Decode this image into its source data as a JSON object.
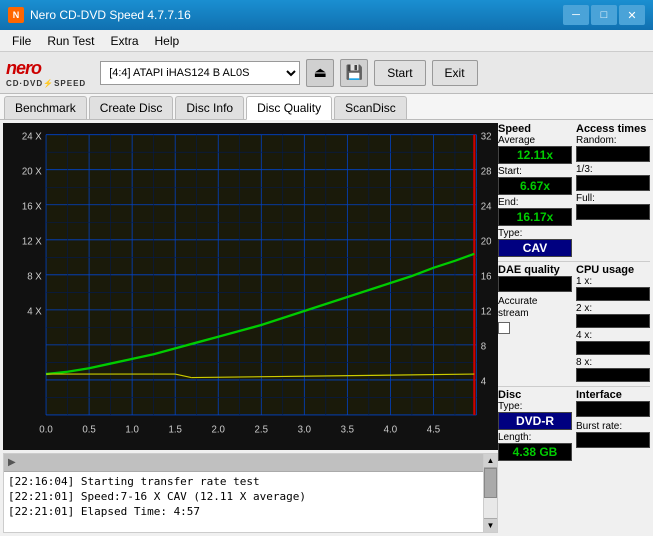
{
  "titleBar": {
    "title": "Nero CD-DVD Speed 4.7.7.16",
    "minBtn": "─",
    "maxBtn": "□",
    "closeBtn": "✕"
  },
  "menuBar": {
    "items": [
      "File",
      "Run Test",
      "Extra",
      "Help"
    ]
  },
  "toolbar": {
    "driveLabel": "[4:4]  ATAPI iHAS124  B AL0S",
    "startBtn": "Start",
    "exitBtn": "Exit"
  },
  "tabs": {
    "items": [
      "Benchmark",
      "Create Disc",
      "Disc Info",
      "Disc Quality",
      "ScanDisc"
    ],
    "active": "Disc Quality"
  },
  "chart": {
    "title": "Disc Quality",
    "xLabels": [
      "0.0",
      "0.5",
      "1.0",
      "1.5",
      "2.0",
      "2.5",
      "3.0",
      "3.5",
      "4.0",
      "4.5"
    ],
    "yLabelsLeft": [
      "24 X",
      "20 X",
      "16 X",
      "12 X",
      "8 X",
      "4 X"
    ],
    "yLabelsRight": [
      "32",
      "28",
      "24",
      "20",
      "16",
      "12",
      "8",
      "4"
    ]
  },
  "rightPanel": {
    "speedSection": {
      "header": "Speed",
      "averageLabel": "Average",
      "averageValue": "12.11x",
      "startLabel": "Start:",
      "startValue": "6.67x",
      "endLabel": "End:",
      "endValue": "16.17x",
      "typeLabel": "Type:",
      "typeValue": "CAV"
    },
    "accessSection": {
      "header": "Access times",
      "randomLabel": "Random:",
      "onethirdLabel": "1/3:",
      "fullLabel": "Full:"
    },
    "cpuSection": {
      "header": "CPU usage",
      "1x": "1 x:",
      "2x": "2 x:",
      "4x": "4 x:",
      "8x": "8 x:"
    },
    "daeSection": {
      "header": "DAE quality"
    },
    "accurateStream": {
      "label": "Accurate\nstream"
    },
    "discSection": {
      "discTypeHeader": "Disc",
      "typeLabel": "Type:",
      "typeValue": "DVD-R",
      "lengthLabel": "Length:",
      "lengthValue": "4.38 GB"
    },
    "interfaceSection": {
      "header": "Interface",
      "burstLabel": "Burst rate:"
    }
  },
  "log": {
    "lines": [
      "[22:16:04]  Starting transfer rate test",
      "[22:21:01]  Speed:7-16 X CAV (12.11 X average)",
      "[22:21:01]  Elapsed Time: 4:57"
    ]
  }
}
